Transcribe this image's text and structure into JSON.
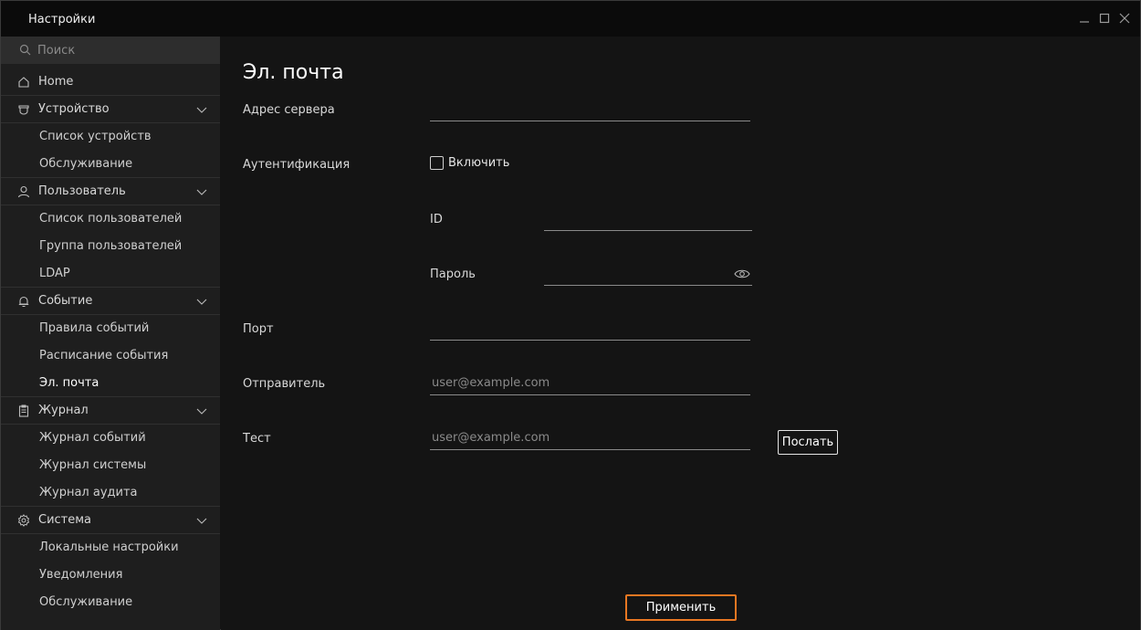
{
  "window": {
    "title": "Настройки"
  },
  "sidebar": {
    "search_placeholder": "Поиск",
    "items": [
      {
        "label": "Home",
        "icon": "home-icon"
      },
      {
        "label": "Устройство",
        "icon": "device-icon",
        "expanded": true
      },
      {
        "label": "Список устройств"
      },
      {
        "label": "Обслуживание"
      },
      {
        "label": "Пользователь",
        "icon": "user-icon",
        "expanded": true
      },
      {
        "label": "Список пользователей"
      },
      {
        "label": "Группа пользователей"
      },
      {
        "label": "LDAP"
      },
      {
        "label": "Событие",
        "icon": "bell-icon",
        "expanded": true
      },
      {
        "label": "Правила событий"
      },
      {
        "label": "Расписание события"
      },
      {
        "label": "Эл. почта",
        "active": true
      },
      {
        "label": "Журнал",
        "icon": "clipboard-icon",
        "expanded": true
      },
      {
        "label": "Журнал событий"
      },
      {
        "label": "Журнал системы"
      },
      {
        "label": "Журнал аудита"
      },
      {
        "label": "Система",
        "icon": "gear-icon",
        "expanded": true
      },
      {
        "label": "Локальные настройки"
      },
      {
        "label": "Уведомления"
      },
      {
        "label": "Обслуживание"
      }
    ]
  },
  "main": {
    "title": "Эл. почта",
    "server_address": {
      "label": "Адрес сервера",
      "value": ""
    },
    "authentication": {
      "label": "Аутентификация",
      "checkbox_label": "Включить",
      "checked": false
    },
    "id": {
      "label": "ID",
      "value": ""
    },
    "password": {
      "label": "Пароль",
      "value": ""
    },
    "port": {
      "label": "Порт",
      "value": ""
    },
    "sender": {
      "label": "Отправитель",
      "value": "",
      "placeholder": "user@example.com"
    },
    "test": {
      "label": "Тест",
      "value": "",
      "placeholder": "user@example.com"
    },
    "send_button": "Послать",
    "apply_button": "Применить"
  },
  "colors": {
    "background": "#141414",
    "sidebar": "#1e1e1e",
    "accent": "#e87722"
  }
}
